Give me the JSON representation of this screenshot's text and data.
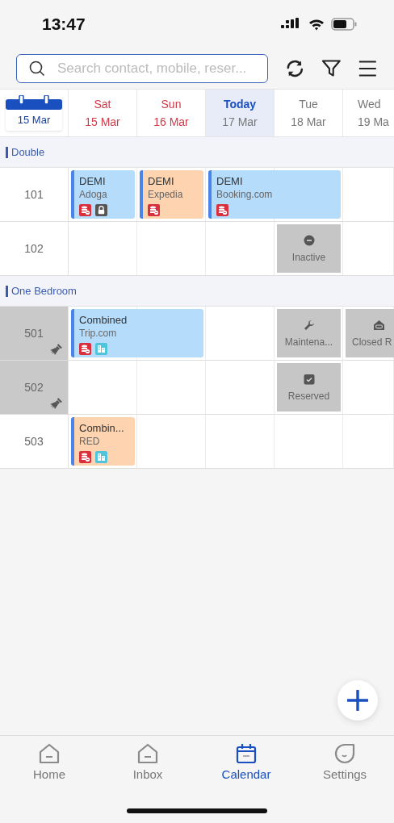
{
  "status_bar": {
    "time": "13:47"
  },
  "search": {
    "placeholder": "Search contact, mobile, reser..."
  },
  "date_picker": {
    "label": "15 Mar"
  },
  "days": [
    {
      "weekday": "Sat",
      "date": "15 Mar",
      "weekend": true,
      "selected": false
    },
    {
      "weekday": "Sun",
      "date": "16 Mar",
      "weekend": true,
      "selected": false
    },
    {
      "weekday": "Today",
      "date": "17 Mar",
      "weekend": false,
      "selected": true
    },
    {
      "weekday": "Tue",
      "date": "18 Mar",
      "weekend": false,
      "selected": false
    },
    {
      "weekday": "Wed",
      "date": "19 Ma",
      "weekend": false,
      "selected": false
    }
  ],
  "groups": [
    {
      "name": "Double",
      "rooms": [
        {
          "room": "101",
          "dirty": false,
          "slots": [
            {
              "kind": "booking",
              "name": "DEMI",
              "source": "Adoga",
              "color": "#b6dcfb",
              "badges": [
                {
                  "kind": "payment"
                },
                {
                  "kind": "lock"
                }
              ]
            },
            {
              "kind": "booking",
              "name": "DEMI",
              "source": "Expedia",
              "color": "#fdd3b0",
              "badges": [
                {
                  "kind": "payment"
                }
              ]
            },
            {
              "kind": "booking",
              "name": "DEMI",
              "source": "Booking.com",
              "color": "#b6dcfb",
              "badges": [
                {
                  "kind": "payment"
                }
              ]
            },
            {
              "kind": "continued"
            },
            {
              "kind": "empty"
            }
          ]
        },
        {
          "room": "102",
          "dirty": false,
          "slots": [
            {
              "kind": "empty"
            },
            {
              "kind": "empty"
            },
            {
              "kind": "empty"
            },
            {
              "kind": "inactive",
              "label": "Inactive"
            },
            {
              "kind": "empty"
            }
          ]
        }
      ]
    },
    {
      "name": "One Bedroom",
      "rooms": [
        {
          "room": "501",
          "dirty": true,
          "slots": [
            {
              "kind": "booking",
              "name": "Combined",
              "source": "Trip.com",
              "color": "#b6dcfb",
              "badges": [
                {
                  "kind": "payment"
                },
                {
                  "kind": "building"
                }
              ]
            },
            {
              "kind": "continued"
            },
            {
              "kind": "empty"
            },
            {
              "kind": "maintenance",
              "label": "Maintena..."
            },
            {
              "kind": "closed",
              "label": "Closed R"
            }
          ]
        },
        {
          "room": "502",
          "dirty": true,
          "slots": [
            {
              "kind": "empty"
            },
            {
              "kind": "empty"
            },
            {
              "kind": "empty"
            },
            {
              "kind": "reserved",
              "label": "Reserved"
            },
            {
              "kind": "empty"
            }
          ]
        },
        {
          "room": "503",
          "dirty": false,
          "slots": [
            {
              "kind": "booking",
              "name": "Combin...",
              "source": "RED",
              "color": "#fdd3b0",
              "badges": [
                {
                  "kind": "payment"
                },
                {
                  "kind": "building"
                }
              ]
            },
            {
              "kind": "empty"
            },
            {
              "kind": "empty"
            },
            {
              "kind": "empty"
            },
            {
              "kind": "empty"
            }
          ]
        }
      ]
    }
  ],
  "tabs": [
    {
      "label": "Home",
      "kind": "home",
      "selected": false
    },
    {
      "label": "Inbox",
      "kind": "home",
      "selected": false
    },
    {
      "label": "Calendar",
      "kind": "calendar",
      "selected": true
    },
    {
      "label": "Settings",
      "kind": "leaf",
      "selected": false
    }
  ]
}
